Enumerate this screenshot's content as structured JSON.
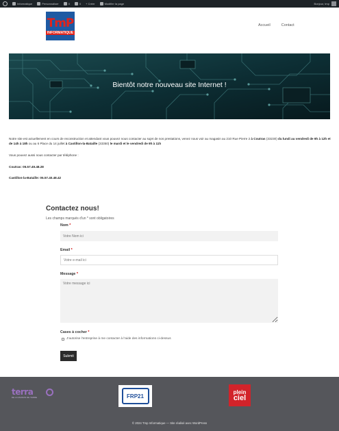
{
  "admin_bar": {
    "items": [
      "Informatique",
      "Personnaliser",
      "0",
      "0",
      "+ Créer",
      "Modifier la page"
    ],
    "greeting": "Bonjour, tmp"
  },
  "header": {
    "logo": {
      "top_text": "TmP",
      "bottom_text": "INFORMATIQUE"
    },
    "nav": [
      "Accueil",
      "Contact"
    ]
  },
  "hero": {
    "title": "Bientôt notre nouveau site Internet !"
  },
  "intro": {
    "paragraph_1": "Notre site est actuellement en cours de reconstruction et attendant vous pouvez nous contacter au sujet de nos prestations, venez nous voir au magasin au 210 Rue Pierre 2 ",
    "paragraph_1_bold_a": "à Coutras",
    "paragraph_1_b": " (33230) ",
    "paragraph_1_bold_b": "du lundi au vendredi de 9h à 12h et de 14h à 18h",
    "paragraph_1_c": " ou au 6 Place du 14 juillet ",
    "paragraph_1_bold_c": "à Castillon-la-Bataille",
    "paragraph_1_d": " (33350) ",
    "paragraph_1_bold_d": "le mardi et le vendredi de 9h à 11h",
    "paragraph_2": "Vous pouvez aussi nous contacter par téléphone :",
    "phone_1": "Coutras: 05.57.49.48.28",
    "phone_2": "Castillon-la-Bataille: 05.57.40.48.42"
  },
  "form": {
    "title": "Contactez nous!",
    "required_note": "Les champs marqués d'un * sont obligatoires",
    "name_label": "Nom",
    "name_placeholder": "Votre Nom ici",
    "email_label": "Email",
    "email_placeholder": "Votre e-mail ici",
    "message_label": "Message",
    "message_placeholder": "Votre message ici",
    "checkbox_group_label": "Cases à cocher",
    "checkbox_label": "J'autorise l'entreprise à me contacter à l'aide des informations ci-dessus",
    "submit_label": "Submit",
    "required_star": "*"
  },
  "footer": {
    "terra_logo": "terra",
    "terra_sub": "DE LA MAISON DE TERRE",
    "ffb_logo": "FRP21",
    "pleinciel_logo": [
      "plein",
      "ciel"
    ],
    "copyright": "© 2024 Tmp Informatique — Site réalisé avec WordPress"
  },
  "colors": {
    "admin_bar": "#1d2327",
    "footer": "#55565b",
    "accent_red": "#e2231a",
    "logo_blue": "#1e5aa3"
  }
}
